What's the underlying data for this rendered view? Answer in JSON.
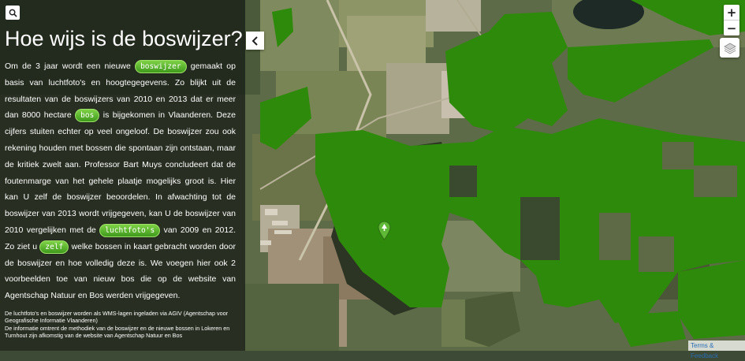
{
  "panel": {
    "title": "Hoe wijs is de boswijzer?",
    "paragraph": {
      "t1": "Om de 3 jaar wordt een nieuwe ",
      "pill1": "boswijzer",
      "t2": " gemaakt op basis van luchtfoto's en hoogtegegevens. Zo blijkt uit de resultaten van de boswijzers van 2010 en 2013 dat er meer dan 8000 hectare ",
      "pill2": "bos",
      "t3": " is bijgekomen in Vlaanderen. Deze cijfers stuiten echter op veel ongeloof. De boswijzer zou ook rekening houden met bossen die spontaan zijn ontstaan, maar de kritiek zwelt aan. Professor Bart Muys concludeert dat de foutenmarge van het gehele plaatje mogelijks groot is. Hier kan U zelf de boswijzer beoordelen. In afwachting tot de boswijzer van 2013 wordt vrijgegeven, kan U de boswijzer van 2010 vergelijken met de ",
      "pill3": "luchtfoto's",
      "t4": " van 2009 en 2012. Zo ziet u ",
      "pill4": "zelf",
      "t5": " welke bossen in kaart gebracht worden door de boswijzer en hoe volledig deze is. We voegen hier ook 2 voorbeelden toe van nieuw bos die op de website van Agentschap Natuur en Bos werden vrijgegeven."
    },
    "footer_line1": "De luchtfoto's en boswijzer worden als WMS-lagen ingeladen via AGIV (Agentschap voor Geografische Informatie Vlaanderen)",
    "footer_line2": "De informatie omtrent de methodiek van de boswijzer en de nieuwe bossen in Lokeren en Turnhout zijn afkomstig van de website van Agentschap Natuur en Bos"
  },
  "controls": {
    "zoom_in": "+",
    "zoom_out": "−",
    "collapse_icon": "chevron-left-icon",
    "search_icon": "search-icon",
    "layers_icon": "layers-icon",
    "marker_icon": "tree-marker-icon"
  },
  "attribution": "Terms & Feedback",
  "colors": {
    "forest_overlay": "#2e8a0a",
    "pill_green": "#5cb52f",
    "panel_bg": "rgba(20,24,20,0.72)"
  }
}
